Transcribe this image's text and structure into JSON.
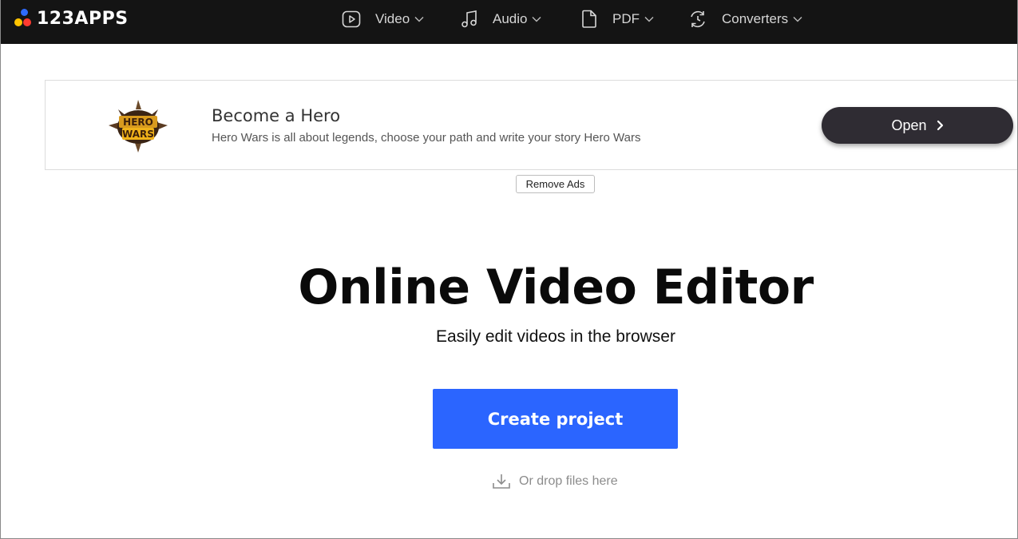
{
  "header": {
    "logo_text": "123APPS",
    "nav": [
      {
        "label": "Video",
        "icon": "play-circle-icon"
      },
      {
        "label": "Audio",
        "icon": "music-note-icon"
      },
      {
        "label": "PDF",
        "icon": "document-icon"
      },
      {
        "label": "Converters",
        "icon": "refresh-icon"
      }
    ]
  },
  "ad": {
    "logo_line1": "HERO",
    "logo_line2": "WARS",
    "title": "Become a Hero",
    "description": "Hero Wars is all about legends, choose your path and write your story Hero Wars",
    "open_label": "Open",
    "remove_ads_label": "Remove Ads"
  },
  "main": {
    "title": "Online Video Editor",
    "subtitle": "Easily edit videos in the browser",
    "create_label": "Create project",
    "drop_label": "Or drop files here"
  },
  "colors": {
    "topbar": "#141414",
    "accent": "#2b65ff",
    "ad_button": "#2f2c33"
  }
}
